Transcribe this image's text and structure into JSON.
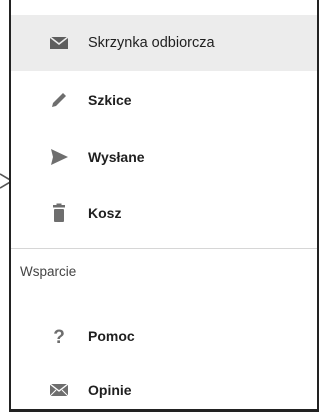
{
  "drawer": {
    "items": [
      {
        "label": "Skrzynka odbiorcza",
        "icon": "inbox-envelope-icon",
        "active": true
      },
      {
        "label": "Szkice",
        "icon": "pencil-icon",
        "active": false
      },
      {
        "label": "Wysłane",
        "icon": "send-icon",
        "active": false
      },
      {
        "label": "Kosz",
        "icon": "trash-icon",
        "active": false
      }
    ],
    "support_section": {
      "header": "Wsparcie",
      "items": [
        {
          "label": "Pomoc",
          "icon": "question-mark-icon"
        },
        {
          "label": "Opinie",
          "icon": "feedback-envelope-icon"
        }
      ]
    }
  },
  "colors": {
    "active_background": "#ececec",
    "icon_color": "#6e6e6e",
    "text_color": "#1f1f1f",
    "divider": "#d6d6d6"
  }
}
